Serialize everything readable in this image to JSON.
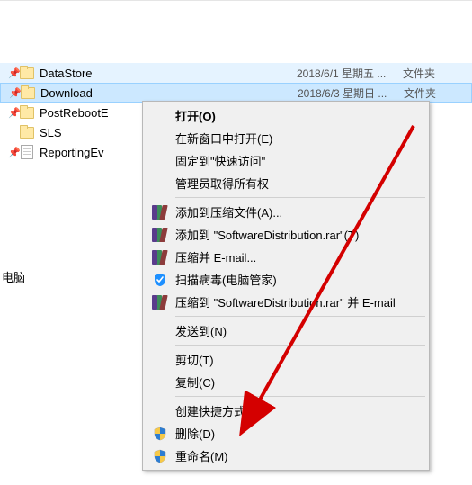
{
  "files": [
    {
      "name": "DataStore",
      "date": "2018/6/1 星期五 ...",
      "type": "文件夹",
      "pin": true,
      "kind": "folder",
      "state": "hover"
    },
    {
      "name": "Download",
      "date": "2018/6/3 星期日 ...",
      "type": "文件夹",
      "pin": true,
      "kind": "folder",
      "state": "selected"
    },
    {
      "name": "PostRebootE",
      "date": "",
      "type": "",
      "pin": true,
      "kind": "folder",
      "state": ""
    },
    {
      "name": "SLS",
      "date": "",
      "type": "",
      "pin": true,
      "kind": "folder",
      "state": ""
    },
    {
      "name": "ReportingEv",
      "date": "",
      "type": "",
      "pin": true,
      "kind": "file",
      "state": ""
    }
  ],
  "sidebar_label": "电脑",
  "menu": {
    "open": "打开(O)",
    "open_new_window": "在新窗口中打开(E)",
    "pin_quick_access": "固定到\"快速访问\"",
    "admin_perm": "管理员取得所有权",
    "add_archive": "添加到压缩文件(A)...",
    "add_to_rar": "添加到 \"SoftwareDistribution.rar\"(T)",
    "compress_email": "压缩并 E-mail...",
    "scan_virus": "扫描病毒(电脑管家)",
    "compress_rar_email": "压缩到 \"SoftwareDistribution.rar\" 并 E-mail",
    "send_to": "发送到(N)",
    "cut": "剪切(T)",
    "copy": "复制(C)",
    "create_shortcut": "创建快捷方式(S)",
    "delete": "删除(D)",
    "rename": "重命名(M)"
  }
}
